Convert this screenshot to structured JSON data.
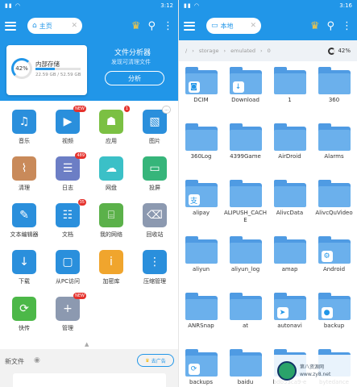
{
  "left": {
    "status": {
      "time": "3:12"
    },
    "tab": {
      "label": "主页"
    },
    "storage": {
      "percent": "42%",
      "name": "内部存储",
      "size": "22.59 GB / 52.59 GB",
      "used_fraction": 0.42
    },
    "analyzer": {
      "title": "文件分析器",
      "subtitle": "发现可清理文件",
      "button": "分析"
    },
    "categories": [
      {
        "label": "音乐",
        "icon": "music-note-icon",
        "color": "#2a8fdc"
      },
      {
        "label": "视频",
        "icon": "video-play-icon",
        "color": "#2a8fdc",
        "badge": "NEW"
      },
      {
        "label": "应用",
        "icon": "android-icon",
        "color": "#7bc043",
        "badge": "1"
      },
      {
        "label": "图片",
        "icon": "image-icon",
        "color": "#2a8fdc",
        "badge": "..."
      },
      {
        "label": "清理",
        "icon": "broom-icon",
        "color": "#c98a5a"
      },
      {
        "label": "日志",
        "icon": "stack-icon",
        "color": "#6c7ec5",
        "badge": "489"
      },
      {
        "label": "网盘",
        "icon": "cloud-icon",
        "color": "#3bc0c7"
      },
      {
        "label": "投屏",
        "icon": "cast-icon",
        "color": "#36b57a"
      },
      {
        "label": "文本编辑器",
        "icon": "edit-icon",
        "color": "#2a8fdc"
      },
      {
        "label": "文档",
        "icon": "document-icon",
        "color": "#2a8fdc",
        "badge": "35"
      },
      {
        "label": "我的网络",
        "icon": "router-icon",
        "color": "#5bb14a"
      },
      {
        "label": "回收站",
        "icon": "trash-icon",
        "color": "#8c99b0"
      },
      {
        "label": "下载",
        "icon": "download-icon",
        "color": "#2a8fdc"
      },
      {
        "label": "从PC访问",
        "icon": "pc-access-icon",
        "color": "#2a8fdc"
      },
      {
        "label": "加密库",
        "icon": "lock-icon",
        "color": "#f0a52d"
      },
      {
        "label": "压缩管理",
        "icon": "zip-icon",
        "color": "#2a8fdc"
      },
      {
        "label": "快传",
        "icon": "sync-icon",
        "color": "#4cb848"
      },
      {
        "label": "管理",
        "icon": "plus-icon",
        "color": "#8c99b0",
        "badge": "NEW"
      }
    ],
    "recent": {
      "title": "新文件",
      "ad_button": "去广告"
    }
  },
  "right": {
    "status": {
      "time": "3:16"
    },
    "tab": {
      "label": "本地"
    },
    "path": [
      "/",
      "storage",
      "emulated",
      "0"
    ],
    "usage": "42%",
    "folders": [
      {
        "name": "DCIM",
        "overlay": "camera-icon"
      },
      {
        "name": "Download",
        "overlay": "download-icon"
      },
      {
        "name": "1"
      },
      {
        "name": "360"
      },
      {
        "name": "360Log"
      },
      {
        "name": "4399Game"
      },
      {
        "name": "AirDroid"
      },
      {
        "name": "Alarms"
      },
      {
        "name": "alipay",
        "overlay": "alipay-icon"
      },
      {
        "name": "ALIPUSH_CACHE"
      },
      {
        "name": "AlivcData"
      },
      {
        "name": "AlivcQuVideo"
      },
      {
        "name": "aliyun"
      },
      {
        "name": "aliyun_log"
      },
      {
        "name": "amap"
      },
      {
        "name": "Android",
        "overlay": "gear-icon"
      },
      {
        "name": "ANRSnap"
      },
      {
        "name": "at"
      },
      {
        "name": "autonavi",
        "overlay": "autonavi-icon"
      },
      {
        "name": "backup",
        "overlay": "qq-icon"
      },
      {
        "name": "backups",
        "overlay": "sync-icon"
      },
      {
        "name": "baidu"
      },
      {
        "name": "bdb53ca9-e"
      },
      {
        "name": "bytedance"
      }
    ],
    "watermark": {
      "line1": "第八资源网",
      "line2": "www.zy8.net"
    }
  }
}
